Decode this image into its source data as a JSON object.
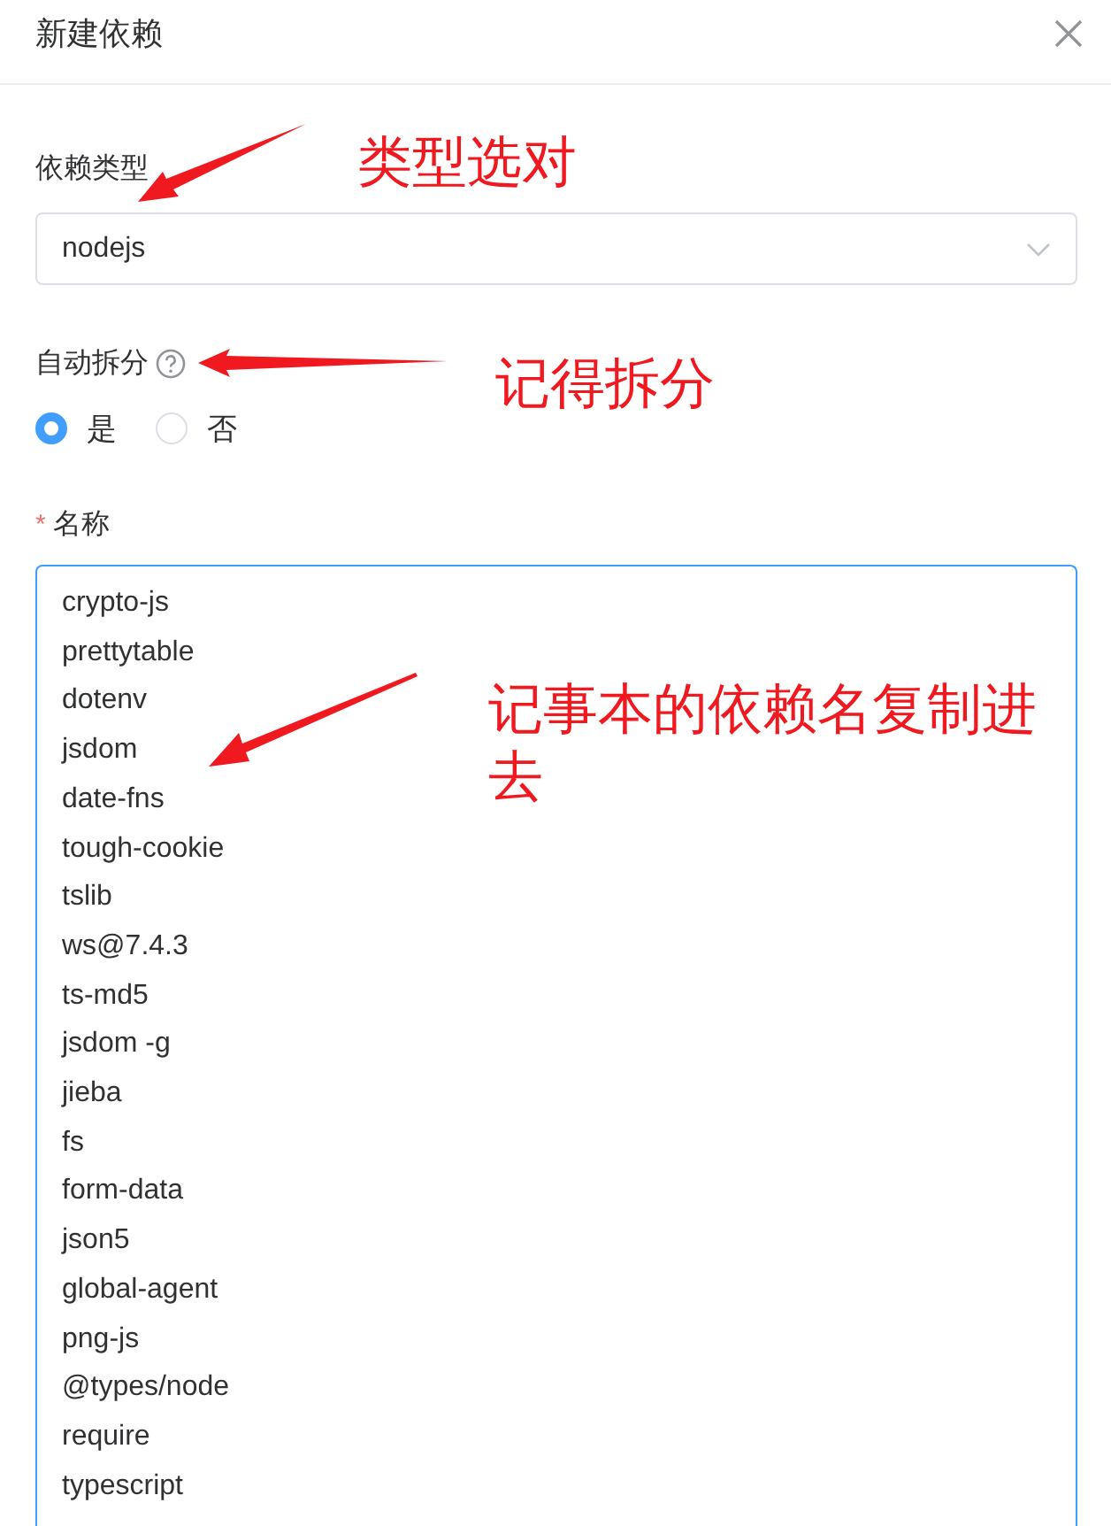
{
  "dialog": {
    "title": "新建依赖"
  },
  "form": {
    "type_field": {
      "label": "依赖类型",
      "value": "nodejs"
    },
    "auto_split": {
      "label": "自动拆分",
      "options": [
        {
          "label": "是",
          "selected": true
        },
        {
          "label": "否",
          "selected": false
        }
      ]
    },
    "name_field": {
      "label": "名称",
      "required_mark": "*",
      "value_lines": [
        "crypto-js",
        "prettytable",
        "dotenv",
        "jsdom",
        "date-fns",
        "tough-cookie",
        "tslib",
        "ws@7.4.3",
        "ts-md5",
        "jsdom -g",
        "jieba",
        "fs",
        "form-data",
        "json5",
        "global-agent",
        "png-js",
        "@types/node",
        "require",
        "typescript"
      ]
    }
  },
  "annotations": [
    {
      "text": "类型选对"
    },
    {
      "text": "记得拆分"
    },
    {
      "text": "记事本的依赖名复制进去"
    }
  ]
}
